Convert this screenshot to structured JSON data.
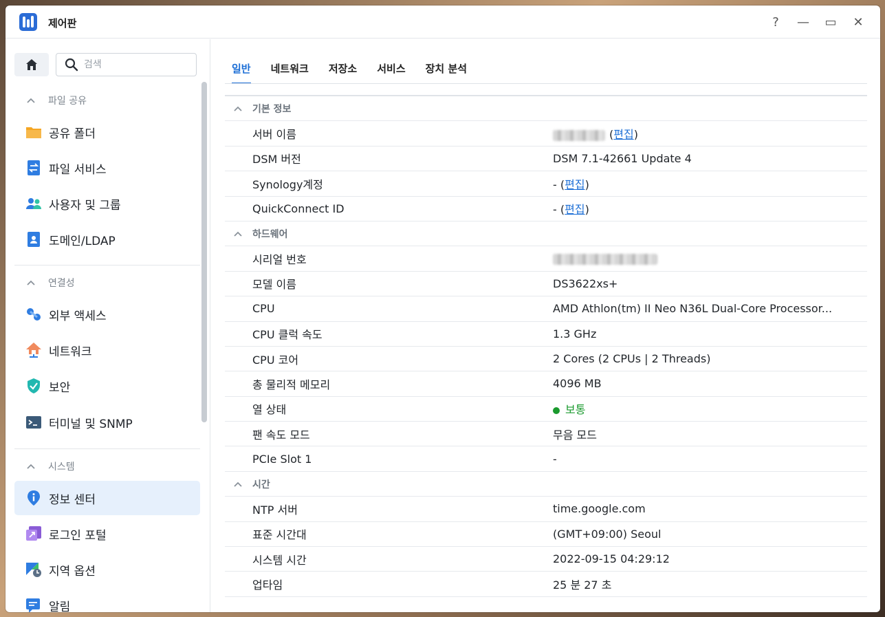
{
  "window": {
    "title": "제어판",
    "controls": [
      "?",
      "—",
      "▭",
      "✕"
    ]
  },
  "sidebar": {
    "search_placeholder": "검색",
    "sections": [
      {
        "label": "파일 공유",
        "items": [
          {
            "label": "공유 폴더",
            "icon": "folder-icon"
          },
          {
            "label": "파일 서비스",
            "icon": "file-services-icon"
          },
          {
            "label": "사용자 및 그룹",
            "icon": "users-icon"
          },
          {
            "label": "도메인/LDAP",
            "icon": "domain-icon"
          }
        ]
      },
      {
        "label": "연결성",
        "items": [
          {
            "label": "외부 액세스",
            "icon": "external-access-icon"
          },
          {
            "label": "네트워크",
            "icon": "network-icon"
          },
          {
            "label": "보안",
            "icon": "shield-icon"
          },
          {
            "label": "터미널 및 SNMP",
            "icon": "terminal-icon"
          }
        ]
      },
      {
        "label": "시스템",
        "items": [
          {
            "label": "정보 센터",
            "icon": "info-icon"
          },
          {
            "label": "로그인 포털",
            "icon": "login-portal-icon"
          },
          {
            "label": "지역 옵션",
            "icon": "regional-options-icon"
          },
          {
            "label": "알림",
            "icon": "notification-icon"
          }
        ]
      }
    ],
    "active_item": "정보 센터"
  },
  "tabs": [
    "일반",
    "네트워크",
    "저장소",
    "서비스",
    "장치 분석"
  ],
  "active_tab": "일반",
  "groups": [
    {
      "label": "기본 정보",
      "rows": [
        {
          "key": "서버 이름",
          "value": "",
          "edit": "편집"
        },
        {
          "key": "DSM 버전",
          "value": "DSM 7.1-42661 Update 4"
        },
        {
          "key": "Synology계정",
          "value": "- (",
          "edit": "편집"
        },
        {
          "key": "QuickConnect ID",
          "value": "- (",
          "edit": "편집"
        }
      ]
    },
    {
      "label": "하드웨어",
      "rows": [
        {
          "key": "시리얼 번호",
          "value": ""
        },
        {
          "key": "모델 이름",
          "value": "DS3622xs+"
        },
        {
          "key": "CPU",
          "value": "AMD Athlon(tm) II Neo N36L Dual-Core Processor..."
        },
        {
          "key": "CPU 클럭 속도",
          "value": "1.3 GHz"
        },
        {
          "key": "CPU 코어",
          "value": "2 Cores (2 CPUs | 2 Threads)"
        },
        {
          "key": "총 물리적 메모리",
          "value": "4096 MB"
        },
        {
          "key": "열 상태",
          "value": "보통"
        },
        {
          "key": "팬 속도 모드",
          "value": "무음 모드"
        },
        {
          "key": "PCIe Slot 1",
          "value": "-"
        }
      ]
    },
    {
      "label": "시간",
      "rows": [
        {
          "key": "NTP 서버",
          "value": "time.google.com"
        },
        {
          "key": "표준 시간대",
          "value": "(GMT+09:00) Seoul"
        },
        {
          "key": "시스템 시간",
          "value": "2022-09-15 04:29:12"
        },
        {
          "key": "업타임",
          "value": "25 분 27 초"
        }
      ]
    }
  ],
  "colors": {
    "accent": "#1d6fd6",
    "status_ok": "#1a9a2e"
  }
}
